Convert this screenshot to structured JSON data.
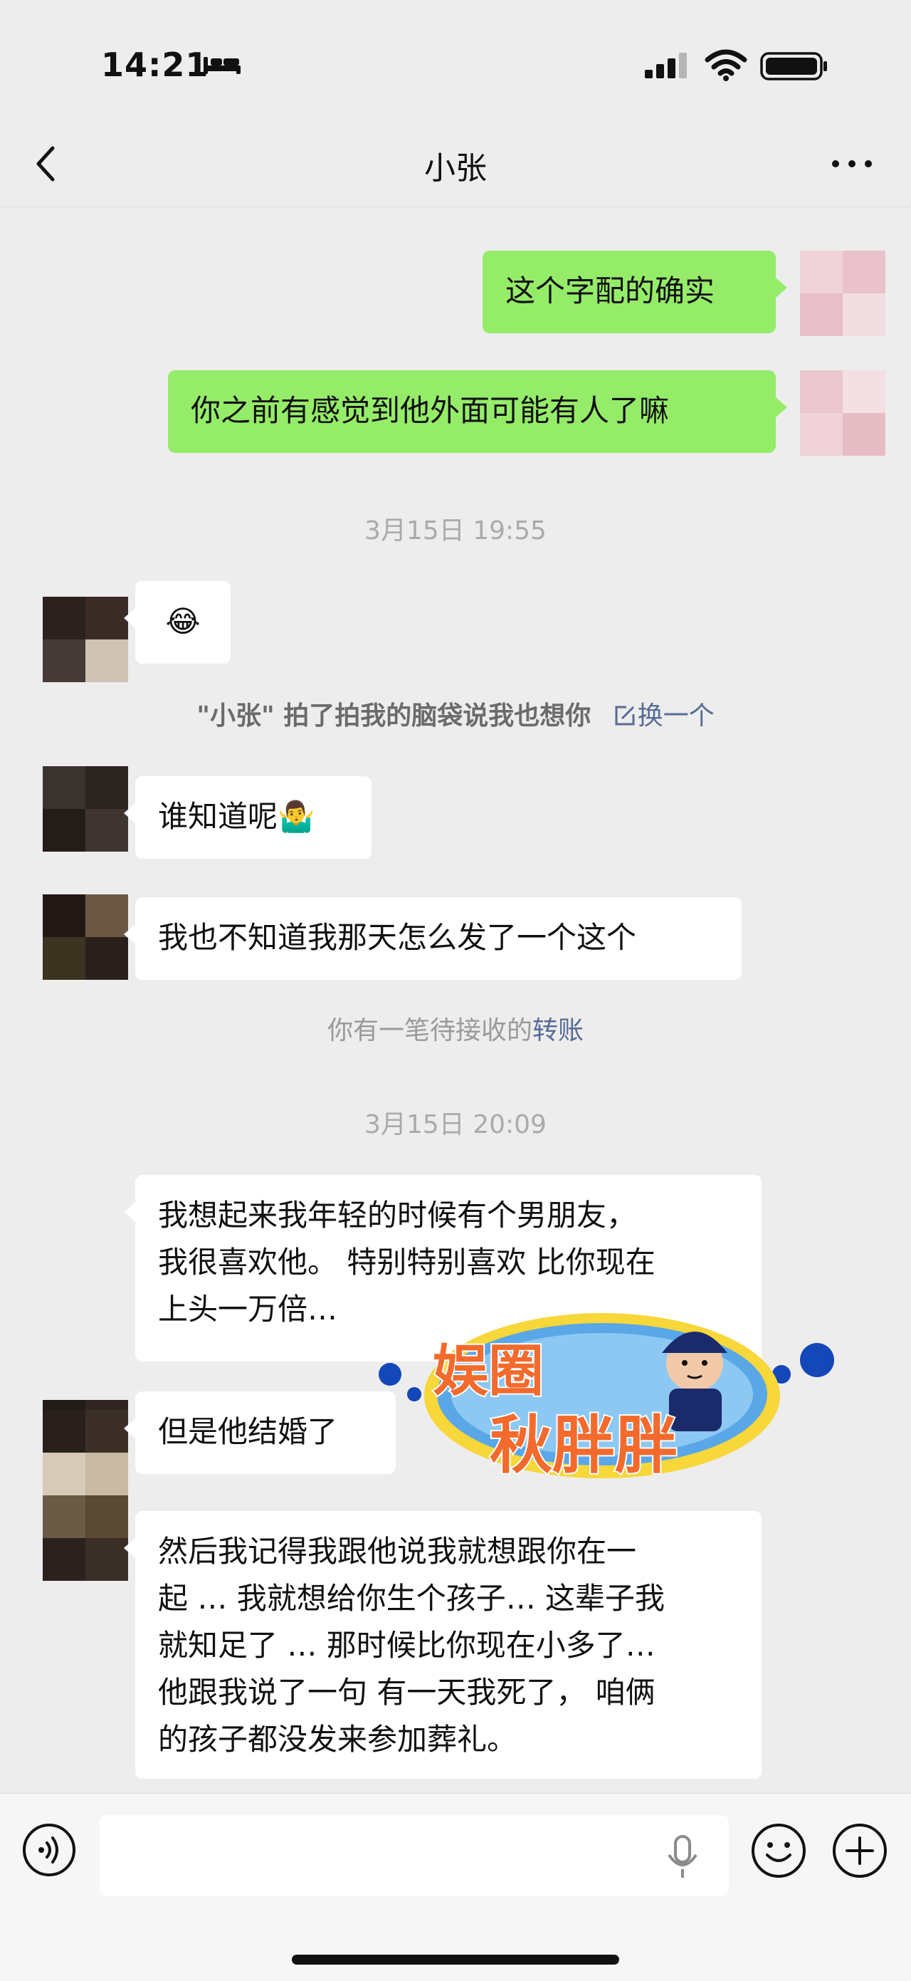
{
  "status_bar": {
    "time": "14:21"
  },
  "header": {
    "title": "小张"
  },
  "messages": [
    {
      "text": "这个字配的确实"
    },
    {
      "text": "你之前有感觉到他外面可能有人了嘛"
    },
    {
      "text": "3月15日 19:55"
    },
    {
      "text": "😂"
    },
    {
      "text": "\"小张\" 拍了拍我的脑袋说我也想你",
      "action": "换一个"
    },
    {
      "text": "谁知道呢🤷‍♂️"
    },
    {
      "text": "我也不知道我那天怎么发了一个这个"
    },
    {
      "text": "你有一笔待接收的",
      "link": "转账"
    },
    {
      "text": "3月15日 20:09"
    },
    {
      "text": "我想起来我年轻的时候有个男朋友，\n我很喜欢他。 特别特别喜欢 比你现在\n上头一万倍…"
    },
    {
      "text": "但是他结婚了"
    },
    {
      "text": "然后我记得我跟他说我就想跟你在一\n起 … 我就想给你生个孩子… 这辈子我\n就知足了 … 那时候比你现在小多了…\n他跟我说了一句 有一天我死了， 咱俩\n的孩子都没发来参加葬礼。"
    }
  ],
  "watermark": {
    "line1": "娱圈",
    "line2": "秋胖胖"
  },
  "input_bar": {
    "value": ""
  },
  "colors": {
    "outgoing_bubble": "#95ec69",
    "incoming_bubble": "#ffffff",
    "background": "#ededed",
    "link": "#576b95"
  },
  "icons": [
    "bed-icon",
    "signal-icon",
    "wifi-icon",
    "battery-icon",
    "back-icon",
    "more-icon",
    "voice-icon",
    "mic-icon",
    "emoji-icon",
    "plus-icon",
    "edit-icon"
  ]
}
